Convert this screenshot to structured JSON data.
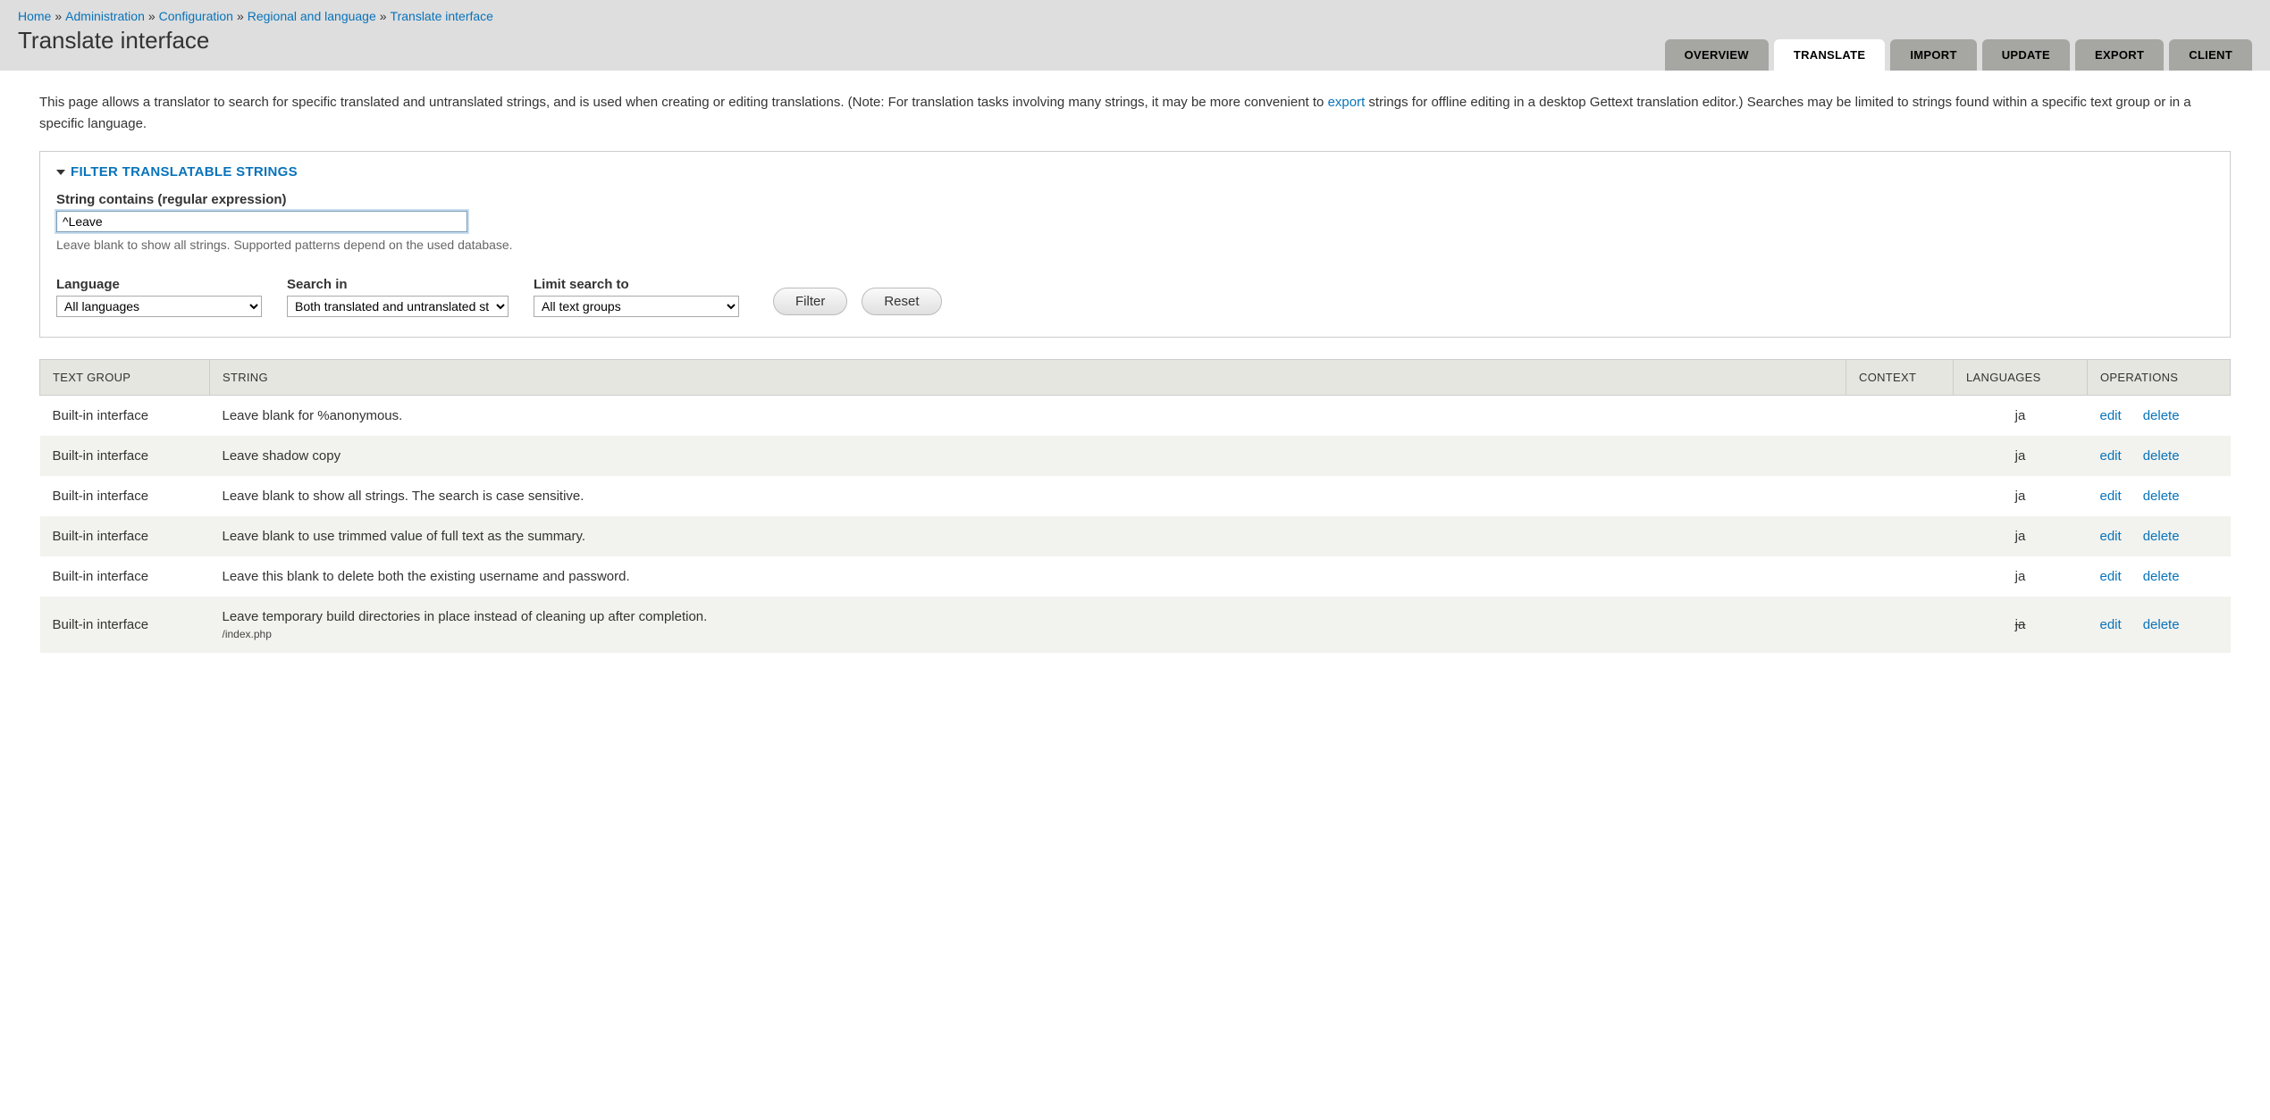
{
  "breadcrumb": [
    {
      "label": "Home"
    },
    {
      "label": "Administration"
    },
    {
      "label": "Configuration"
    },
    {
      "label": "Regional and language"
    },
    {
      "label": "Translate interface"
    }
  ],
  "page_title": "Translate interface",
  "tabs": [
    {
      "label": "Overview"
    },
    {
      "label": "Translate",
      "active": true
    },
    {
      "label": "Import"
    },
    {
      "label": "Update"
    },
    {
      "label": "Export"
    },
    {
      "label": "Client"
    }
  ],
  "intro": {
    "pre": "This page allows a translator to search for specific translated and untranslated strings, and is used when creating or editing translations. (Note: For translation tasks involving many strings, it may be more convenient to ",
    "link": "export",
    "post": " strings for offline editing in a desktop Gettext translation editor.) Searches may be limited to strings found within a specific text group or in a specific language."
  },
  "filter": {
    "legend": "Filter translatable strings",
    "string_label": "String contains (regular expression)",
    "string_value": "^Leave",
    "string_help": "Leave blank to show all strings. Supported patterns depend on the used database.",
    "language_label": "Language",
    "language_value": "All languages",
    "searchin_label": "Search in",
    "searchin_value": "Both translated and untranslated st",
    "limit_label": "Limit search to",
    "limit_value": "All text groups",
    "filter_btn": "Filter",
    "reset_btn": "Reset"
  },
  "table": {
    "headers": {
      "text_group": "Text group",
      "string": "String",
      "context": "Context",
      "languages": "Languages",
      "operations": "Operations"
    },
    "op_labels": {
      "edit": "edit",
      "delete": "delete"
    },
    "rows": [
      {
        "group": "Built-in interface",
        "string": "Leave blank for %anonymous.",
        "context": "",
        "languages": "ja",
        "strike": false,
        "path": ""
      },
      {
        "group": "Built-in interface",
        "string": "Leave shadow copy",
        "context": "",
        "languages": "ja",
        "strike": false,
        "path": ""
      },
      {
        "group": "Built-in interface",
        "string": "Leave blank to show all strings. The search is case sensitive.",
        "context": "",
        "languages": "ja",
        "strike": false,
        "path": ""
      },
      {
        "group": "Built-in interface",
        "string": "Leave blank to use trimmed value of full text as the summary.",
        "context": "",
        "languages": "ja",
        "strike": false,
        "path": ""
      },
      {
        "group": "Built-in interface",
        "string": "Leave this blank to delete both the existing username and password.",
        "context": "",
        "languages": "ja",
        "strike": false,
        "path": ""
      },
      {
        "group": "Built-in interface",
        "string": "Leave temporary build directories in place instead of cleaning up after completion.",
        "context": "",
        "languages": "ja",
        "strike": true,
        "path": "/index.php"
      }
    ]
  }
}
